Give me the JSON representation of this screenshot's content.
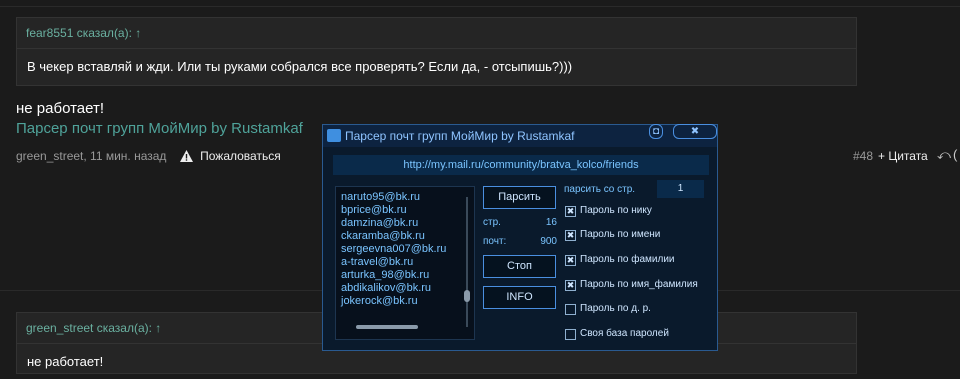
{
  "quote1": {
    "author": "fear8551 сказал(а): ↑",
    "text": "В чекер вставляй и жди. Или ты руками собрался все проверять? Если да, - отсыпишь?)))"
  },
  "post": {
    "text": "не работает!",
    "link": "Парсер почт групп МойМир by Rustamkaf",
    "meta_author": "green_street, 11 мин. назад",
    "report": "Пожаловаться",
    "number": "#48",
    "quote_btn": "+ Цитата",
    "reply_icon": "reply-icon"
  },
  "quote2": {
    "author": "green_street сказал(а): ↑",
    "text": "не работает!"
  },
  "app": {
    "title": "Парсер почт групп МойМир by Rustamkaf",
    "url": "http://my.mail.ru/community/bratva_kolco/friends",
    "emails": [
      "naruto95@bk.ru",
      "bprice@bk.ru",
      "damzina@bk.ru",
      "ckaramba@bk.ru",
      "sergeevna007@bk.ru",
      "a-travel@bk.ru",
      "arturka_98@bk.ru",
      "abdikalikov@bk.ru",
      "jokerock@bk.ru"
    ],
    "parse_btn": "Парсить",
    "pages_label": "стр.",
    "pages_value": "16",
    "mails_label": "почт:",
    "mails_value": "900",
    "stop_btn": "Стоп",
    "info_btn": "INFO",
    "from_label": "парсить со стр.",
    "from_value": "1",
    "options": [
      {
        "label": "Пароль по нику",
        "checked": true
      },
      {
        "label": "Пароль по имени",
        "checked": true
      },
      {
        "label": "Пароль по фамилии",
        "checked": true
      },
      {
        "label": "Пароль по имя_фамилия",
        "checked": true
      },
      {
        "label": "Пароль по д. р.",
        "checked": false
      },
      {
        "label": "Своя база паролей",
        "checked": false
      }
    ]
  }
}
